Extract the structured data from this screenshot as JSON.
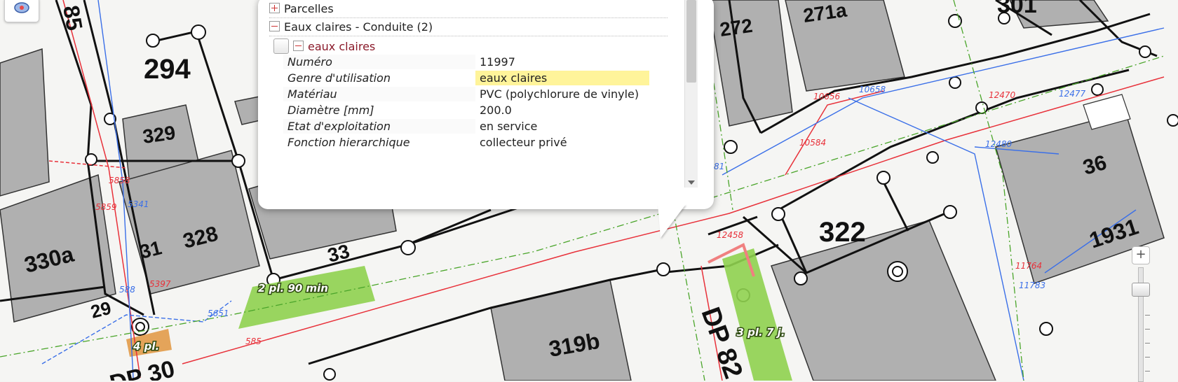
{
  "map": {
    "parcels": [
      "294",
      "329",
      "330a",
      "31",
      "328",
      "33",
      "29",
      "272",
      "271a",
      "36",
      "322",
      "1931",
      "319b"
    ],
    "parcels_partial": [
      "301",
      "85",
      "DP 82",
      "DP 30"
    ],
    "pipe_ids_red": [
      "5858",
      "5859",
      "5397",
      "585",
      "10656",
      "10584",
      "12470",
      "12458",
      "11764"
    ],
    "pipe_ids_blue": [
      "5341",
      "588",
      "5651",
      "10658",
      "12477",
      "12480",
      "11783",
      "81"
    ],
    "parking_labels": [
      "2 pl. 90 min",
      "4 pl.",
      "3 pl. 7 j."
    ]
  },
  "popup": {
    "layers": [
      {
        "label": "Parcelles",
        "expanded": false
      },
      {
        "label": "Eaux claires - Conduite (2)",
        "expanded": true
      }
    ],
    "feature_label": "eaux claires",
    "attributes": [
      {
        "key": "Numéro",
        "value": "11997"
      },
      {
        "key": "Genre d'utilisation",
        "value": "eaux claires"
      },
      {
        "key": "Matériau",
        "value": "PVC (polychlorure de vinyle)"
      },
      {
        "key": "Diamètre [mm]",
        "value": "200.0"
      },
      {
        "key": "Etat d'exploitation",
        "value": "en service"
      },
      {
        "key": "Fonction hierarchique",
        "value": "collecteur privé"
      }
    ]
  },
  "zoom": {
    "in_label": "+"
  }
}
